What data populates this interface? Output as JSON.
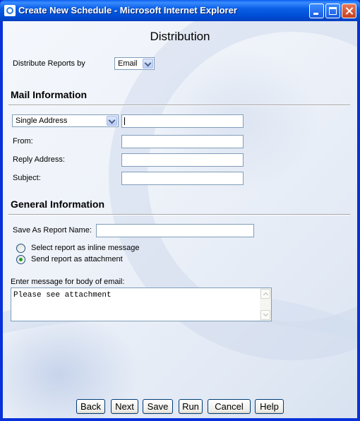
{
  "window": {
    "title": "Create New Schedule - Microsoft Internet Explorer"
  },
  "page": {
    "title": "Distribution"
  },
  "distribute": {
    "label": "Distribute Reports by",
    "selected": "Email"
  },
  "mail_info": {
    "heading": "Mail Information",
    "address_type": "Single Address",
    "address_value": "",
    "from_label": "From:",
    "reply_label": "Reply Address:",
    "subject_label": "Subject:"
  },
  "general_info": {
    "heading": "General Information",
    "save_as_label": "Save As Report Name:",
    "save_as_value": "",
    "radio_inline": "Select report as inline message",
    "radio_attachment": "Send report as attachment",
    "selected_option": "Send report as attachment",
    "body_label": "Enter message for body of email:",
    "body_text": "Please see attachment"
  },
  "buttons": {
    "back": "Back",
    "next": "Next",
    "save": "Save",
    "run": "Run",
    "cancel": "Cancel",
    "help": "Help"
  },
  "colors": {
    "titlebar": "#0a5fe6",
    "window_frame": "#0831d9",
    "separator": "#a6a6a6",
    "radio_dot": "#21a121"
  }
}
